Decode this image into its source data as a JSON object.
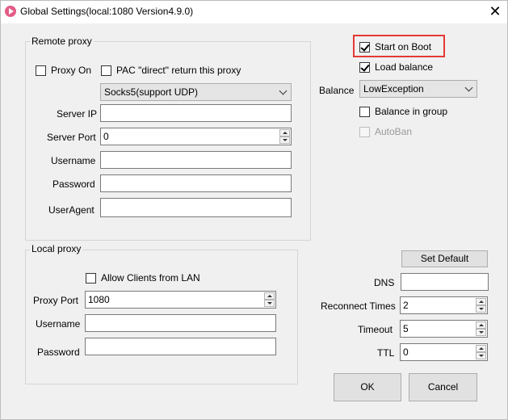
{
  "window": {
    "title": "Global Settings(local:1080 Version4.9.0)",
    "close_glyph": "✕"
  },
  "remote_proxy": {
    "group_label": "Remote proxy",
    "proxy_on_label": "Proxy On",
    "proxy_on_checked": false,
    "pac_label": "PAC \"direct\" return this proxy",
    "pac_checked": false,
    "proxy_type_selected": "Socks5(support UDP)",
    "server_ip_label": "Server IP",
    "server_ip_value": "",
    "server_port_label": "Server Port",
    "server_port_value": "0",
    "username_label": "Username",
    "username_value": "",
    "password_label": "Password",
    "password_value": "",
    "useragent_label": "UserAgent",
    "useragent_value": ""
  },
  "local_proxy": {
    "group_label": "Local proxy",
    "allow_lan_label": "Allow Clients from LAN",
    "allow_lan_checked": false,
    "proxy_port_label": "Proxy Port",
    "proxy_port_value": "1080",
    "username_label": "Username",
    "username_value": "",
    "password_label": "Password",
    "password_value": ""
  },
  "options": {
    "start_on_boot_label": "Start on Boot",
    "start_on_boot_checked": true,
    "load_balance_label": "Load balance",
    "load_balance_checked": true,
    "balance_label": "Balance",
    "balance_selected": "LowException",
    "balance_in_group_label": "Balance in group",
    "balance_in_group_checked": false,
    "autoban_label": "AutoBan",
    "autoban_checked": false
  },
  "network": {
    "set_default_label": "Set Default",
    "dns_label": "DNS",
    "dns_value": "",
    "reconnect_label": "Reconnect Times",
    "reconnect_value": "2",
    "timeout_label": "Timeout",
    "timeout_value": "5",
    "ttl_label": "TTL",
    "ttl_value": "0"
  },
  "footer": {
    "ok_label": "OK",
    "cancel_label": "Cancel"
  },
  "colors": {
    "highlight": "#e53935",
    "app_icon": "#e25c86"
  }
}
